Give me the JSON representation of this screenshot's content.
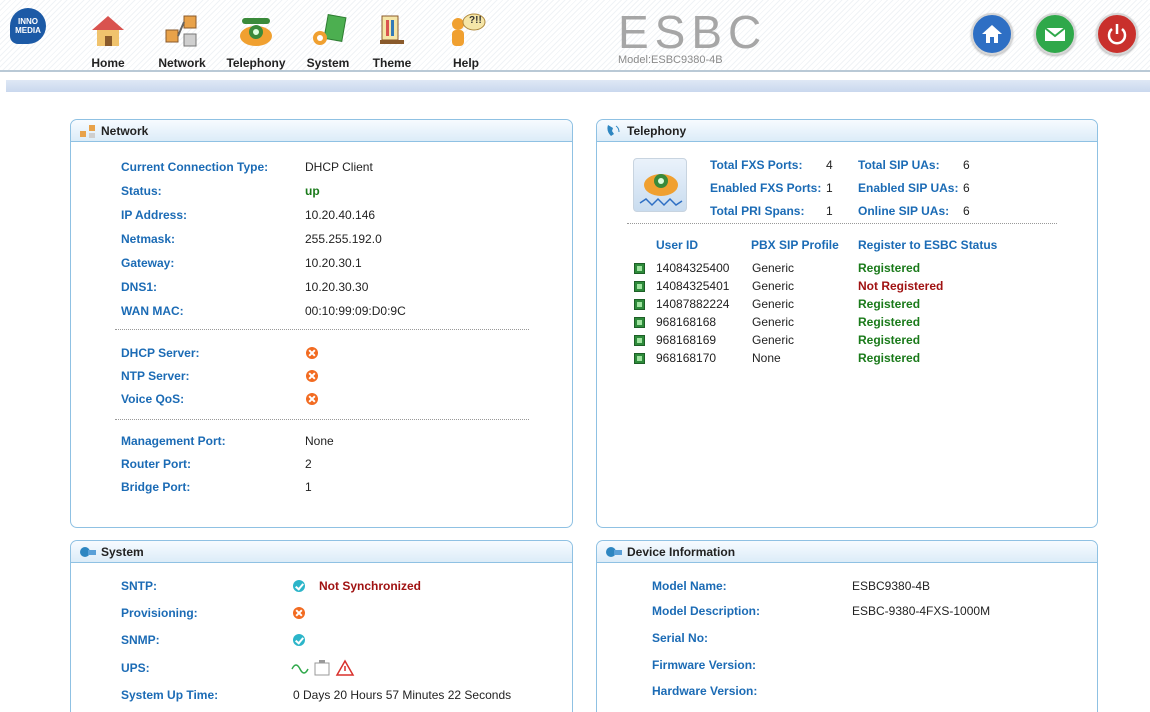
{
  "header": {
    "logo_text": "INNO MEDIA",
    "brand_title": "ESBC",
    "brand_model": "Model:ESBC9380-4B",
    "nav": [
      {
        "label": "Home",
        "icon": "home-icon"
      },
      {
        "label": "Network",
        "icon": "network-icon"
      },
      {
        "label": "Telephony",
        "icon": "telephony-icon"
      },
      {
        "label": "System",
        "icon": "system-icon"
      },
      {
        "label": "Theme",
        "icon": "theme-icon"
      },
      {
        "label": "Help",
        "icon": "help-icon"
      }
    ],
    "help_bubble": "?!!",
    "right_buttons": [
      {
        "icon": "home-icon",
        "color": "#2e6fc4"
      },
      {
        "icon": "mail-icon",
        "color": "#2fa84a"
      },
      {
        "icon": "power-icon",
        "color": "#c9302c"
      }
    ]
  },
  "network": {
    "title": "Network",
    "rows": [
      {
        "label": "Current Connection Type:",
        "value": "DHCP Client"
      },
      {
        "label": "Status:",
        "value": "up"
      },
      {
        "label": "IP Address:",
        "value": "10.20.40.146"
      },
      {
        "label": "Netmask:",
        "value": "255.255.192.0"
      },
      {
        "label": "Gateway:",
        "value": "10.20.30.1"
      },
      {
        "label": "DNS1:",
        "value": "10.20.30.30"
      },
      {
        "label": "WAN MAC:",
        "value": "00:10:99:09:D0:9C"
      }
    ],
    "services": [
      {
        "label": "DHCP Server:",
        "status": "disabled"
      },
      {
        "label": "NTP Server:",
        "status": "disabled"
      },
      {
        "label": "Voice QoS:",
        "status": "disabled"
      }
    ],
    "ports": [
      {
        "label": "Management Port:",
        "value": "None"
      },
      {
        "label": "Router Port:",
        "value": "2"
      },
      {
        "label": "Bridge Port:",
        "value": "1"
      }
    ]
  },
  "telephony": {
    "title": "Telephony",
    "stats_left": [
      {
        "label": "Total FXS Ports:",
        "value": "4"
      },
      {
        "label": "Enabled FXS Ports:",
        "value": "1"
      },
      {
        "label": "Total PRI Spans:",
        "value": "1"
      }
    ],
    "stats_right": [
      {
        "label": "Total SIP UAs:",
        "value": "6"
      },
      {
        "label": "Enabled SIP UAs:",
        "value": "6"
      },
      {
        "label": "Online SIP UAs:",
        "value": "6"
      }
    ],
    "table_headers": [
      "User ID",
      "PBX SIP Profile",
      "Register to ESBC Status"
    ],
    "users": [
      {
        "id": "14084325400",
        "profile": "Generic",
        "status": "Registered",
        "ok": true
      },
      {
        "id": "14084325401",
        "profile": "Generic",
        "status": "Not Registered",
        "ok": false
      },
      {
        "id": "14087882224",
        "profile": "Generic",
        "status": "Registered",
        "ok": true
      },
      {
        "id": "968168168",
        "profile": "Generic",
        "status": "Registered",
        "ok": true
      },
      {
        "id": "968168169",
        "profile": "Generic",
        "status": "Registered",
        "ok": true
      },
      {
        "id": "968168170",
        "profile": "None",
        "status": "Registered",
        "ok": true
      }
    ]
  },
  "system": {
    "title": "System",
    "sntp_label": "SNTP:",
    "sntp_value": "Not Synchronized",
    "provisioning_label": "Provisioning:",
    "snmp_label": "SNMP:",
    "ups_label": "UPS:",
    "uptime_label": "System Up Time:",
    "uptime_value": "0 Days 20 Hours 57 Minutes 22 Seconds"
  },
  "device": {
    "title": "Device Information",
    "rows": [
      {
        "label": "Model Name:",
        "value": "ESBC9380-4B"
      },
      {
        "label": "Model Description:",
        "value": "ESBC-9380-4FXS-1000M"
      },
      {
        "label": "Serial No:",
        "value": ""
      },
      {
        "label": "Firmware Version:",
        "value": ""
      },
      {
        "label": "Hardware Version:",
        "value": ""
      }
    ]
  }
}
